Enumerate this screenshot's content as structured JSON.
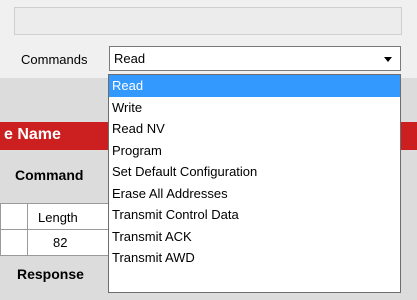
{
  "toolbar": {
    "commands_label": "Commands",
    "commands_value": "Read"
  },
  "panel": {
    "header_partial": "e Name",
    "command_heading": "Command",
    "table": {
      "column_header": "Length",
      "column_value": "82"
    },
    "response_heading": "Response"
  },
  "dropdown": {
    "options": [
      "Read",
      "Write",
      "Read NV",
      "Program",
      "Set Default Configuration",
      "Erase All Addresses",
      "Transmit Control Data",
      "Transmit ACK",
      "Transmit AWD"
    ],
    "selected": "Read"
  }
}
